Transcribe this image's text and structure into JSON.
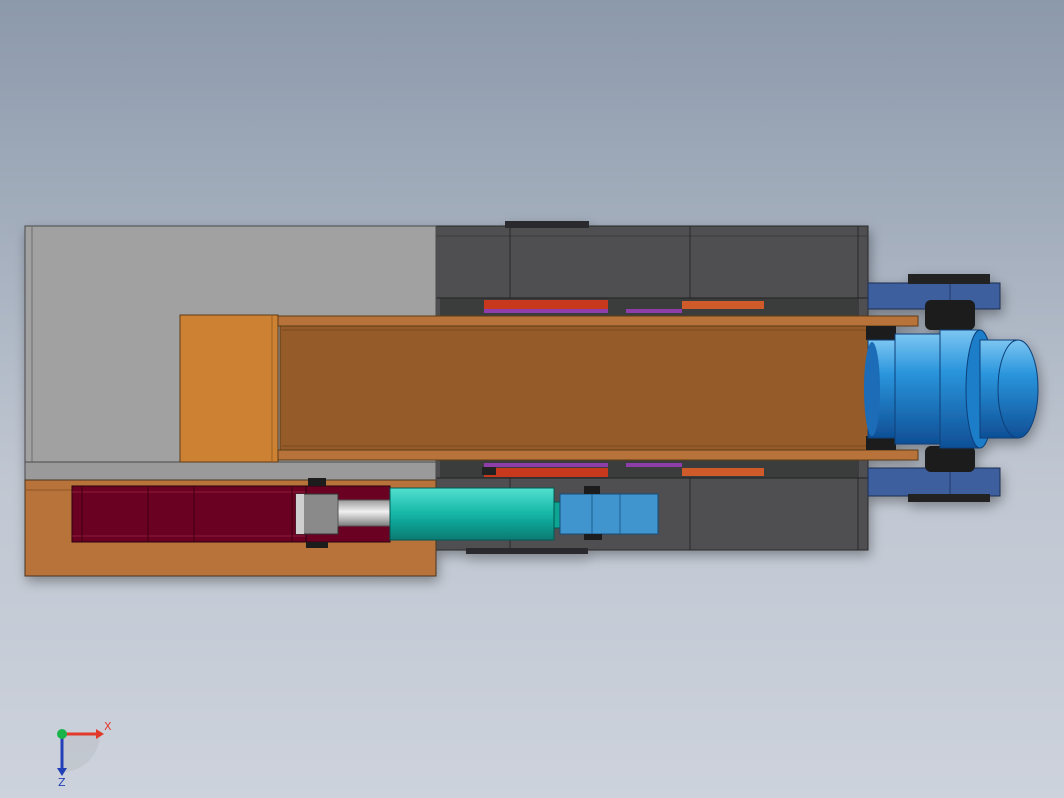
{
  "scene": {
    "view": "top",
    "components": [
      {
        "name": "frame-base",
        "color": "#a1a1a1"
      },
      {
        "name": "gear-housing",
        "color": "#4f4f50"
      },
      {
        "name": "main-beam",
        "color": "#955b29"
      },
      {
        "name": "beam-end-block",
        "color": "#cd8130"
      },
      {
        "name": "lower-bracket",
        "color": "#b8733a"
      },
      {
        "name": "cylinder-body",
        "color": "#6a0020"
      },
      {
        "name": "piston-rod",
        "color": "#c8c8c8"
      },
      {
        "name": "cylinder-sleeve",
        "color": "#14b6a6"
      },
      {
        "name": "rod-clevis",
        "color": "#3f95cf"
      },
      {
        "name": "motor-body",
        "color": "#1d86d3"
      },
      {
        "name": "motor-mount",
        "color": "#3d5e9e"
      },
      {
        "name": "gear-strip-upper",
        "color": "#c8391c"
      },
      {
        "name": "gear-strip-lower",
        "color": "#c8391c"
      }
    ]
  },
  "triad": {
    "x_label": "X",
    "z_label": "Z",
    "x_color": "#e23a2a",
    "z_color": "#2140b8",
    "y_color": "#18b44a"
  }
}
